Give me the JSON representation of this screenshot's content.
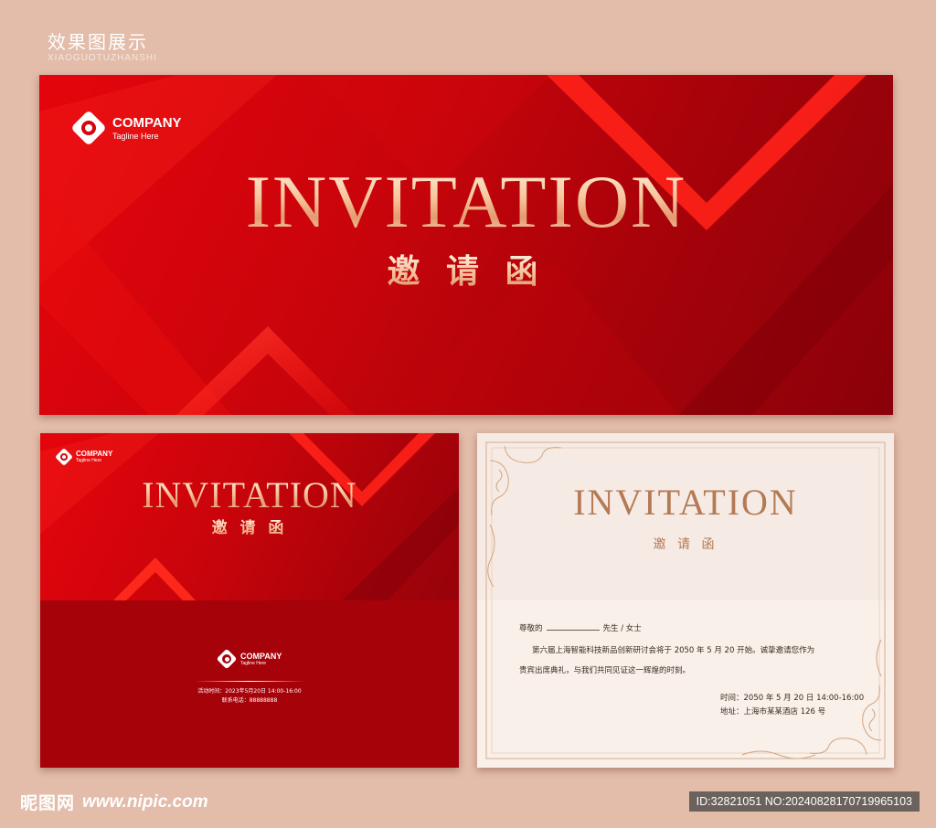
{
  "header": {
    "title": "效果图展示",
    "subtitle": "XIAOGUOTUZHANSHI"
  },
  "banner": {
    "company": "COMPANY",
    "tagline": "Tagline Here",
    "title_en": "INVITATION",
    "title_cn": "邀 请 函"
  },
  "card_front": {
    "company": "COMPANY",
    "tagline": "Tagline Here",
    "title_en": "INVITATION",
    "title_cn": "邀 请 函",
    "back_company": "COMPANY",
    "back_tagline": "Tagline Here",
    "event_time": "活动时间：2023年5月20日 14:00-16:00",
    "contact": "联系电话：88888888"
  },
  "card_inside": {
    "title_en": "INVITATION",
    "title_cn": "邀 请 函",
    "salutation_prefix": "尊敬的",
    "salutation_suffix": "先生 / 女士",
    "body_line1": "第六届上海智能科技新品创新研讨会将于 2050 年 5 月 20 开始。诚挚邀请您作为",
    "body_line2": "贵宾出席典礼，与我们共同见证这一辉煌的时刻。",
    "time": "时间：2050 年 5 月 20 日 14:00-16:00",
    "address": "地址：上海市某某酒店 126 号"
  },
  "footer": {
    "site_logo": "昵图网",
    "site_url": "www.nipic.com",
    "image_id": "ID:32821051 NO:20240828170719965103"
  },
  "colors": {
    "background": "#e3bcaa",
    "primary_red": "#c8040b",
    "deep_red": "#a6020a",
    "gold": "#f4c19a",
    "cream": "#f6ebe4",
    "brown_text": "#b47a55"
  }
}
